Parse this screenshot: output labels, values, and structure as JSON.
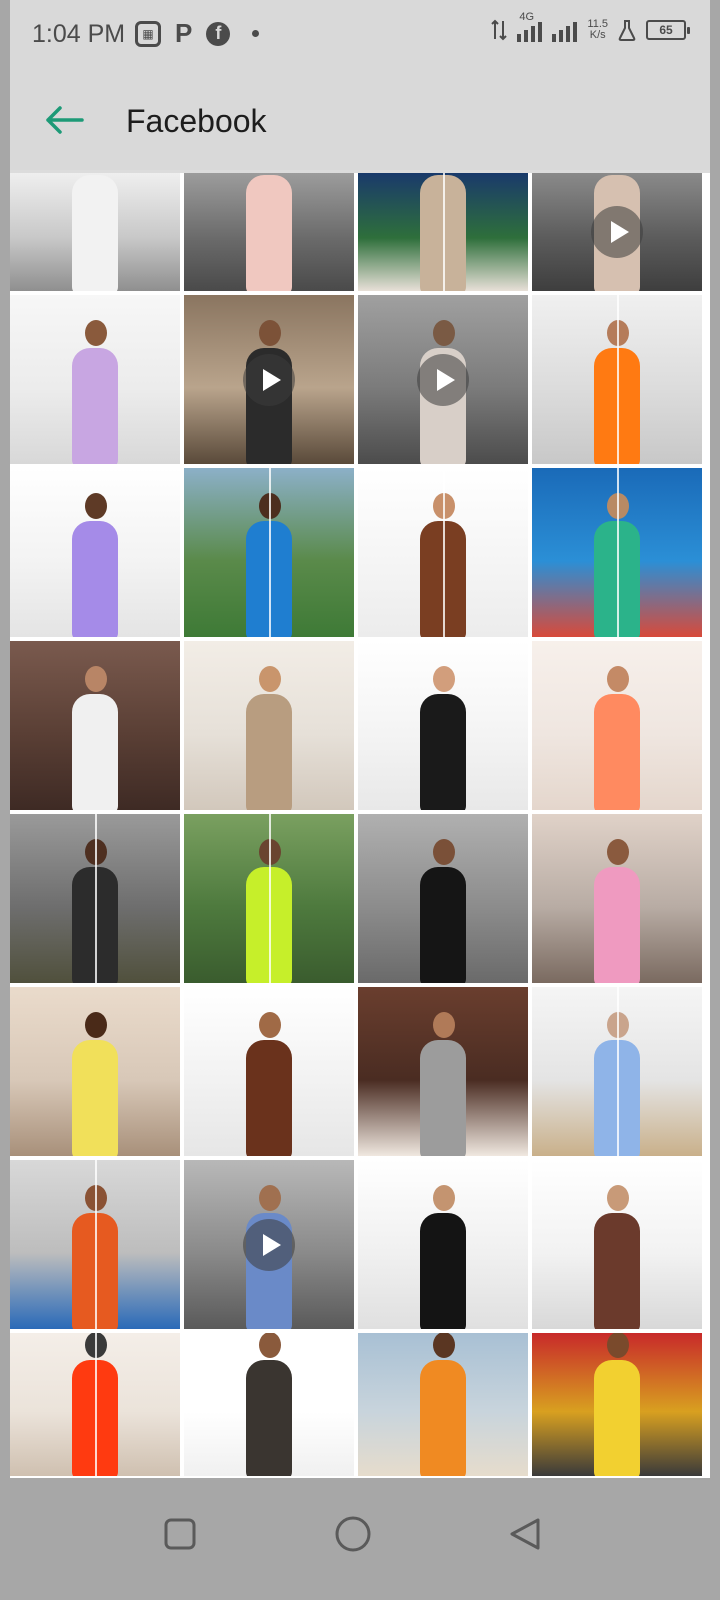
{
  "status_bar": {
    "time": "1:04 PM",
    "notification_icons": [
      "image-gallery-icon",
      "p-app-icon",
      "facebook-icon",
      "more-dot-icon"
    ],
    "network_type": "4G",
    "speed_value": "11.5",
    "speed_unit": "K/s",
    "battery": "65"
  },
  "app_bar": {
    "back_icon": "arrow-left-icon",
    "title": "Facebook"
  },
  "gallery": {
    "tiles": [
      {
        "bg": "#c8c8c8",
        "top": "#efefef",
        "bottom": "#8f8f8f",
        "skin": "#d9c5b5",
        "outfit": "#f2f2f2",
        "video": false,
        "split": false
      },
      {
        "bg": "#6b6b6b",
        "top": "#9c9c9c",
        "bottom": "#4a4a4a",
        "skin": "#c49a7c",
        "outfit": "#f0c8c0",
        "video": false,
        "split": false
      },
      {
        "bg": "#2e6f3b",
        "top": "#1a3a6b",
        "bottom": "#e8e0d8",
        "skin": "#c9a98a",
        "outfit": "#c8b29a",
        "video": false,
        "split": true
      },
      {
        "bg": "#5c5c5c",
        "top": "#8a8a8a",
        "bottom": "#3e3e3e",
        "skin": "#caa48a",
        "outfit": "#d6c0b0",
        "video": true,
        "split": false
      },
      {
        "bg": "#ececec",
        "top": "#f7f7f7",
        "bottom": "#d8d8d8",
        "skin": "#8a5a3c",
        "outfit": "#c8a6e2",
        "video": false,
        "split": false
      },
      {
        "bg": "#b9a48c",
        "top": "#8a7560",
        "bottom": "#5a4a3a",
        "skin": "#7c5238",
        "outfit": "#2b2b2b",
        "video": true,
        "split": false
      },
      {
        "bg": "#7b7b7b",
        "top": "#a0a0a0",
        "bottom": "#4c4c4c",
        "skin": "#7a5a44",
        "outfit": "#d8cfc8",
        "video": true,
        "split": false
      },
      {
        "bg": "#dcdcdc",
        "top": "#f0f0f0",
        "bottom": "#c8c8c8",
        "skin": "#b57c5a",
        "outfit": "#ff7a12",
        "video": false,
        "split": true
      },
      {
        "bg": "#f3f3f3",
        "top": "#ffffff",
        "bottom": "#e4e4e4",
        "skin": "#5e3a26",
        "outfit": "#a58be8",
        "video": false,
        "split": false
      },
      {
        "bg": "#5a8a4a",
        "top": "#8cb0c8",
        "bottom": "#3e7a36",
        "skin": "#4c2e1e",
        "outfit": "#1f7ed0",
        "video": false,
        "split": true
      },
      {
        "bg": "#f5f5f5",
        "top": "#ffffff",
        "bottom": "#ececec",
        "skin": "#c8906a",
        "outfit": "#7a3e22",
        "video": false,
        "split": true
      },
      {
        "bg": "#2b8fd6",
        "top": "#1a6ab8",
        "bottom": "#d84a3a",
        "skin": "#b88a64",
        "outfit": "#2bb38a",
        "video": false,
        "split": true
      },
      {
        "bg": "#5a3f35",
        "top": "#7a5a4e",
        "bottom": "#3e2a24",
        "skin": "#b88566",
        "outfit": "#f0f0f0",
        "video": false,
        "split": false
      },
      {
        "bg": "#e6e0d8",
        "top": "#f2ede6",
        "bottom": "#d2c8bc",
        "skin": "#c9956c",
        "outfit": "#b89d80",
        "video": false,
        "split": false
      },
      {
        "bg": "#f4f4f4",
        "top": "#ffffff",
        "bottom": "#e8e8e8",
        "skin": "#d29e7c",
        "outfit": "#1a1a1a",
        "video": false,
        "split": false
      },
      {
        "bg": "#efe6e0",
        "top": "#f7f0eb",
        "bottom": "#e4d6cc",
        "skin": "#c48a66",
        "outfit": "#ff8a60",
        "video": false,
        "split": false
      },
      {
        "bg": "#6e6e6e",
        "top": "#9a9a9a",
        "bottom": "#50503c",
        "skin": "#4e2f20",
        "outfit": "#2c2c2c",
        "video": false,
        "split": true
      },
      {
        "bg": "#4e7a3e",
        "top": "#7aa060",
        "bottom": "#3a5c2e",
        "skin": "#6a4430",
        "outfit": "#c6ef2a",
        "video": false,
        "split": true
      },
      {
        "bg": "#8c8c8c",
        "top": "#b0b0b0",
        "bottom": "#6a6a6a",
        "skin": "#7a5038",
        "outfit": "#151515",
        "video": false,
        "split": false
      },
      {
        "bg": "#b8aca4",
        "top": "#e0d2c8",
        "bottom": "#7a6a60",
        "skin": "#8a5a3e",
        "outfit": "#ef9ac0",
        "video": false,
        "split": false
      },
      {
        "bg": "#d8c8b8",
        "top": "#eadbcb",
        "bottom": "#a8907a",
        "skin": "#4a2a18",
        "outfit": "#f1e05a",
        "video": false,
        "split": false
      },
      {
        "bg": "#f2f2f2",
        "top": "#ffffff",
        "bottom": "#e6e6e6",
        "skin": "#a06a46",
        "outfit": "#6a321c",
        "video": false,
        "split": false
      },
      {
        "bg": "#4a2c22",
        "top": "#6a3e2e",
        "bottom": "#f0e8e0",
        "skin": "#b07a58",
        "outfit": "#9c9c9c",
        "video": false,
        "split": false
      },
      {
        "bg": "#e4e4e4",
        "top": "#f5f5f5",
        "bottom": "#c9b08a",
        "skin": "#c9a48c",
        "outfit": "#8fb4e8",
        "video": false,
        "split": true
      },
      {
        "bg": "#bdbdbd",
        "top": "#d8d8d8",
        "bottom": "#2a6ab8",
        "skin": "#8a5234",
        "outfit": "#e65a20",
        "video": false,
        "split": true
      },
      {
        "bg": "#8a8a8a",
        "top": "#b8b8b8",
        "bottom": "#5a5a5a",
        "skin": "#a07050",
        "outfit": "#6a8ac8",
        "video": true,
        "split": false
      },
      {
        "bg": "#f0f0f0",
        "top": "#ffffff",
        "bottom": "#e0e0e0",
        "skin": "#c49470",
        "outfit": "#141414",
        "video": false,
        "split": false
      },
      {
        "bg": "#f2f2f2",
        "top": "#ffffff",
        "bottom": "#d8d8d8",
        "skin": "#c89a78",
        "outfit": "#6b3a2c",
        "video": false,
        "split": false
      },
      {
        "bg": "#ebe3da",
        "top": "#f4eee8",
        "bottom": "#cfc0b0",
        "skin": "#3a3a3a",
        "outfit": "#ff3a10",
        "video": false,
        "split": true
      },
      {
        "bg": "#ffffff",
        "top": "#ffffff",
        "bottom": "#f0f0f0",
        "skin": "#8a5a3c",
        "outfit": "#3a3530",
        "video": false,
        "split": false
      },
      {
        "bg": "#c8d4dc",
        "top": "#a8c0d4",
        "bottom": "#e6dccc",
        "skin": "#5a3622",
        "outfit": "#f08a22",
        "video": false,
        "split": false
      },
      {
        "bg": "#d8a020",
        "top": "#c82a2a",
        "bottom": "#3a3a3a",
        "skin": "#7a4a2c",
        "outfit": "#f2d030",
        "video": false,
        "split": false
      }
    ]
  },
  "nav_bar": {
    "buttons": [
      "recents-square-icon",
      "home-circle-icon",
      "back-triangle-icon"
    ]
  }
}
